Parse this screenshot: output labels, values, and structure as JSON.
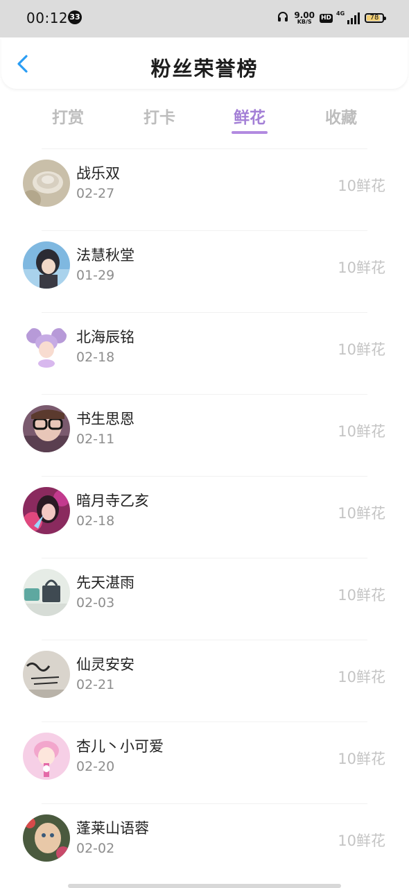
{
  "status_bar": {
    "time": "00:12",
    "notification_count": "33",
    "net_speed_value": "9.00",
    "net_speed_unit": "KB/S",
    "hd_label": "HD",
    "network_label": "4G",
    "battery_level": "78"
  },
  "header": {
    "title": "粉丝荣誉榜"
  },
  "tabs": [
    {
      "label": "打赏"
    },
    {
      "label": "打卡"
    },
    {
      "label": "鲜花"
    },
    {
      "label": "收藏"
    }
  ],
  "active_tab": "鲜花",
  "accent_color": "#a37fd6",
  "list": [
    {
      "name": "战乐双",
      "date": "02-27",
      "value": "10鲜花"
    },
    {
      "name": "法慧秋堂",
      "date": "01-29",
      "value": "10鲜花"
    },
    {
      "name": "北海辰铭",
      "date": "02-18",
      "value": "10鲜花"
    },
    {
      "name": "书生思恩",
      "date": "02-11",
      "value": "10鲜花"
    },
    {
      "name": "暗月寺乙亥",
      "date": "02-18",
      "value": "10鲜花"
    },
    {
      "name": "先天湛雨",
      "date": "02-03",
      "value": "10鲜花"
    },
    {
      "name": "仙灵安安",
      "date": "02-21",
      "value": "10鲜花"
    },
    {
      "name": "杏儿丶小可爱",
      "date": "02-20",
      "value": "10鲜花"
    },
    {
      "name": "蓬莱山语蓉",
      "date": "02-02",
      "value": "10鲜花"
    }
  ]
}
